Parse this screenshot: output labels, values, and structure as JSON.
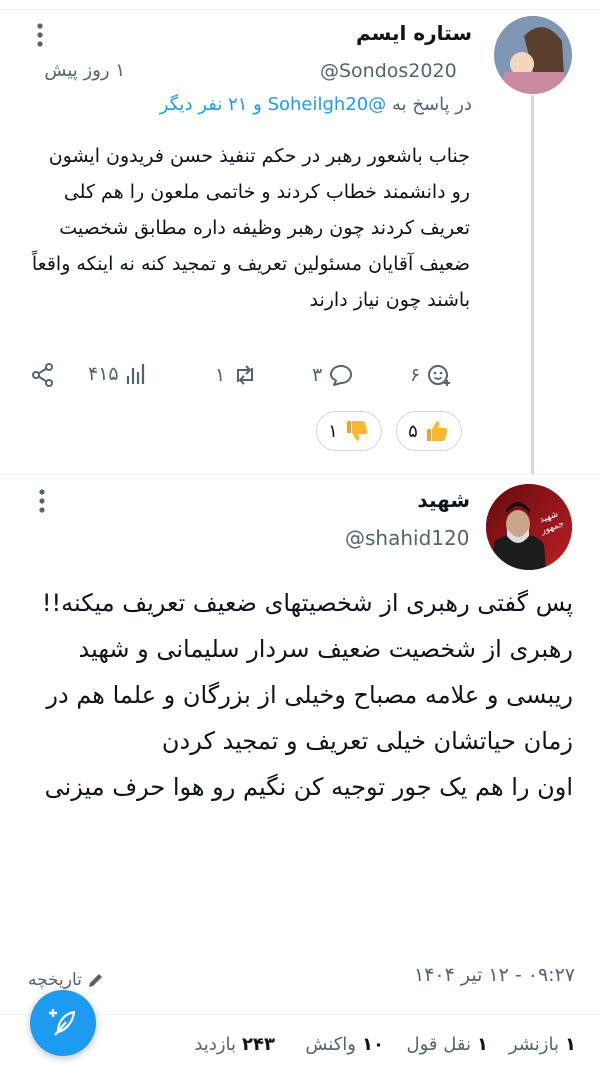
{
  "reply": {
    "author_name": "ستاره ایسم",
    "handle": "@Sondos2020",
    "time": "۱ روز پیش",
    "in_reply_prefix": "در پاسخ به",
    "in_reply_handle": "@Soheilgh20",
    "in_reply_others": "و ۲۱ نفر دیگر",
    "text": "جناب باشعور رهبر در حکم تنفیذ حسن فریدون ایشون رو دانشمند خطاب کردند و خاتمی ملعون را هم کلی تعریف کردند چون رهبر وظیفه داره مطابق شخصیت ضعیف آقایان مسئولین تعریف و تمجید کنه نه اینکه واقعاً باشند چون نیاز دارند",
    "actions": {
      "views": "۴۱۵",
      "retweets": "۱",
      "comments": "۳",
      "reactions": "۶"
    },
    "likes": "۵",
    "dislikes": "۱"
  },
  "main": {
    "author_name": "شهید",
    "handle": "@shahid120",
    "avatar_text": "شهید جمهور",
    "text": "پس گفتی رهبری از شخصیتهای ضعیف تعریف میکنه!!\nرهبری از شخصیت ضعیف سردار سلیمانی و شهید ریبسی و علامه مصباح وخیلی از بزرگان و علما هم در زمان حیاتشان خیلی تعریف و تمجید کردن\nاون را هم یک جور توجیه کن نگیم رو هوا حرف میزنی",
    "timestamp": "۰۹:۲۷ - ۱۲ تیر ۱۴۰۴",
    "edit_label": "تاریخچه"
  },
  "stats": {
    "reposts_count": "۱",
    "reposts_label": "بازنشر",
    "quotes_count": "۱",
    "quotes_label": "نقل قول",
    "reactions_count": "۱۰",
    "reactions_label": "واکنش",
    "views_count": "۲۴۳",
    "views_label": "بازدید"
  },
  "icons": {
    "more": "more-vertical-icon",
    "share": "share-icon",
    "views": "bar-chart-icon",
    "retweet": "retweet-icon",
    "comment": "comment-icon",
    "react": "add-reaction-icon",
    "thumbs_up": "thumbs-up-icon",
    "thumbs_down": "thumbs-down-icon",
    "edit": "pencil-icon",
    "compose": "feather-plus-icon"
  },
  "colors": {
    "accent": "#1d9bf0",
    "text": "#0f1419",
    "muted": "#536471"
  }
}
